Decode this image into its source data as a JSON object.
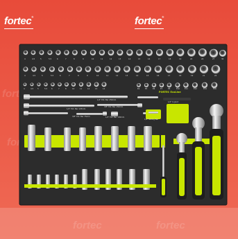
{
  "brand": {
    "name": "fortec",
    "registered": "®",
    "insert_brand": "FORTEC",
    "insert_line": "EcoLine",
    "accent_color": "#c8e600",
    "background_color": "#e84b3a",
    "foam_color": "#2c2c2c"
  },
  "socket_size_labels": {
    "row1": [
      "4",
      "4.5",
      "5",
      "5.5",
      "6",
      "7",
      "8",
      "9",
      "10",
      "11",
      "12",
      "13",
      "14",
      "15",
      "16",
      "17",
      "18",
      "19",
      "22",
      "24",
      "27",
      "30",
      "32"
    ],
    "row2": [
      "4",
      "4.5",
      "5",
      "5.5",
      "6",
      "7",
      "8",
      "9",
      "10",
      "11",
      "12",
      "13",
      "14",
      "15",
      "16",
      "17",
      "18",
      "19",
      "21",
      "22"
    ],
    "row3": [
      "4",
      "4.5",
      "5",
      "5.5",
      "6",
      "7",
      "8",
      "10",
      "11",
      "12",
      "13",
      "14",
      "E4",
      "E5",
      "E6",
      "E7",
      "E8",
      "E10",
      "E11",
      "E12",
      "E14",
      "E16"
    ]
  },
  "extension_labels": [
    "1/2\" Ext. Bar 250mm",
    "1/2\" Ext. Bar 125mm",
    "3/8\" Ext. Bar 150mm",
    "3/8\" Ext. Bar 75mm",
    "1/4\" Ext. Bar 100mm",
    "1/4\" Sliding Bar",
    "1/2\" U-Joint"
  ],
  "tool_icons": [
    "ratchet-1-4-icon",
    "ratchet-3-8-icon",
    "ratchet-1-2-icon",
    "spinner-handle-icon"
  ]
}
